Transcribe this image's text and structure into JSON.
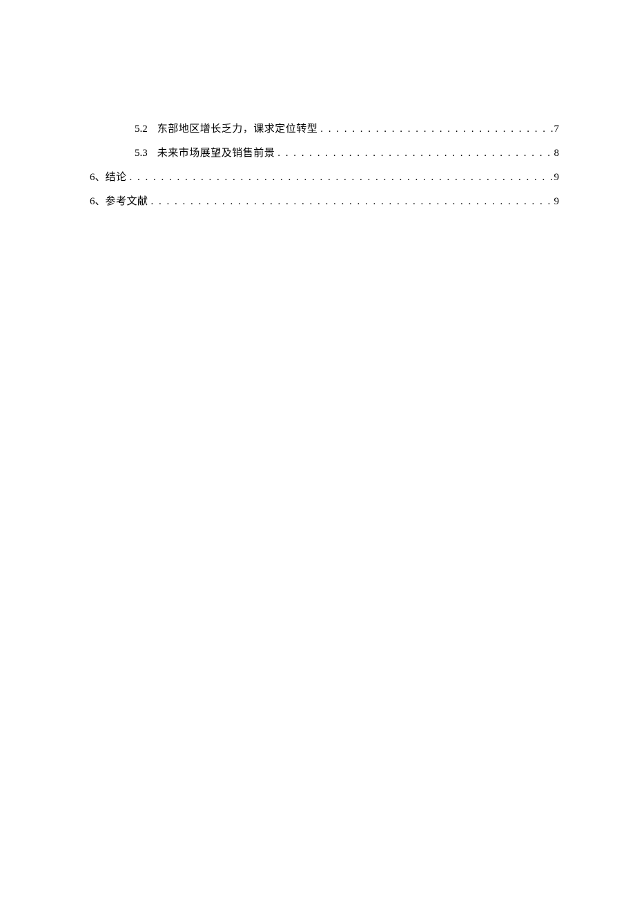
{
  "toc": {
    "entries": [
      {
        "indent": true,
        "num": "5.2",
        "title": "东部地区增长乏力，课求定位转型",
        "page": "7"
      },
      {
        "indent": true,
        "num": "5.3",
        "title": "未来市场展望及销售前景",
        "page": "8"
      },
      {
        "indent": false,
        "num": "6、",
        "title": "结论",
        "page": "9"
      },
      {
        "indent": false,
        "num": "6、",
        "title": "参考文献",
        "page": "9"
      }
    ],
    "dots": ". . . . . . . . . . . . . . . . . . . . . . . . . . . . . . . . . . . . . . . . . . . . . . . . . . . . . . . . . . . . . . . . . . . . . . . . . . . . . . . . . . . . . . . . . . . . . . . . . . . . . . . . . . . . . . . . . ."
  }
}
